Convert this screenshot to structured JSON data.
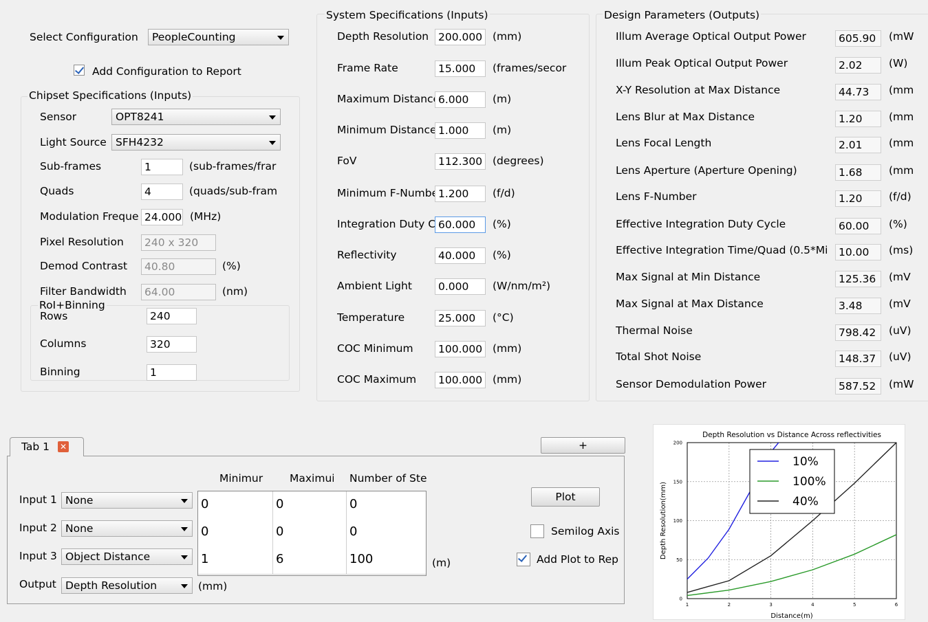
{
  "config": {
    "select_label": "Select Configuration",
    "select_value": "PeopleCounting",
    "add_to_report_label": "Add Configuration to Report",
    "add_to_report_checked": true
  },
  "chipset": {
    "title": "Chipset Specifications (Inputs)",
    "sensor_label": "Sensor",
    "sensor_value": "OPT8241",
    "light_source_label": "Light Source",
    "light_source_value": "SFH4232",
    "subframes_label": "Sub-frames",
    "subframes_value": "1",
    "subframes_unit": "(sub-frames/frar",
    "quads_label": "Quads",
    "quads_value": "4",
    "quads_unit": "(quads/sub-fram",
    "modfreq_label": "Modulation Freque",
    "modfreq_value": "24.000",
    "modfreq_unit": "(MHz)",
    "pixres_label": "Pixel Resolution",
    "pixres_value": "240 x 320",
    "demod_label": "Demod Contrast",
    "demod_value": "40.80",
    "demod_unit": "(%)",
    "filter_label": "Filter Bandwidth",
    "filter_value": "64.00",
    "filter_unit": "(nm)",
    "roi_title": "RoI+Binning",
    "rows_label": "Rows",
    "rows_value": "240",
    "columns_label": "Columns",
    "columns_value": "320",
    "binning_label": "Binning",
    "binning_value": "1"
  },
  "system": {
    "title": "System Specifications (Inputs)",
    "rows": [
      {
        "label": "Depth Resolution",
        "value": "200.000",
        "unit": "(mm)"
      },
      {
        "label": "Frame Rate",
        "value": "15.000",
        "unit": "(frames/secor"
      },
      {
        "label": "Maximum Distance",
        "value": "6.000",
        "unit": "(m)"
      },
      {
        "label": "Minimum Distance",
        "value": "1.000",
        "unit": "(m)"
      },
      {
        "label": "FoV",
        "value": "112.300",
        "unit": "(degrees)"
      },
      {
        "label": "Minimum F-Numbe",
        "value": "1.200",
        "unit": "(f/d)"
      },
      {
        "label": "Integration Duty C",
        "value": "60.000",
        "unit": "(%)"
      },
      {
        "label": "Reflectivity",
        "value": "40.000",
        "unit": "(%)"
      },
      {
        "label": "Ambient Light",
        "value": "0.000",
        "unit": "(W/nm/m²)"
      },
      {
        "label": "Temperature",
        "value": "25.000",
        "unit": "(°C)"
      },
      {
        "label": "COC Minimum",
        "value": "100.000",
        "unit": "(mm)"
      },
      {
        "label": "COC Maximum",
        "value": "100.000",
        "unit": "(mm)"
      }
    ]
  },
  "design": {
    "title": "Design Parameters (Outputs)",
    "rows": [
      {
        "label": "Illum Average Optical Output Power",
        "value": "605.90",
        "unit": "(mW"
      },
      {
        "label": "Illum Peak Optical Output Power",
        "value": "2.02",
        "unit": "(W)"
      },
      {
        "label": "X-Y Resolution at Max Distance",
        "value": "44.73",
        "unit": "(mm"
      },
      {
        "label": "Lens Blur at Max Distance",
        "value": "1.20",
        "unit": "(mm"
      },
      {
        "label": "Lens Focal Length",
        "value": "2.01",
        "unit": "(mm"
      },
      {
        "label": "Lens Aperture (Aperture Opening)",
        "value": "1.68",
        "unit": "(mm"
      },
      {
        "label": "Lens F-Number",
        "value": "1.20",
        "unit": "(f/d)"
      },
      {
        "label": "Effective Integration Duty Cycle",
        "value": "60.00",
        "unit": "(%)"
      },
      {
        "label": "Effective Integration Time/Quad (0.5*Mi",
        "value": "10.00",
        "unit": "(ms)"
      },
      {
        "label": "Max Signal at Min Distance",
        "value": "125.36",
        "unit": "(mV"
      },
      {
        "label": "Max Signal at Max Distance",
        "value": "3.48",
        "unit": "(mV"
      },
      {
        "label": "Thermal Noise",
        "value": "798.42",
        "unit": "(uV)"
      },
      {
        "label": "Total Shot Noise",
        "value": "148.37",
        "unit": "(uV)"
      },
      {
        "label": "Sensor Demodulation Power",
        "value": "587.52",
        "unit": "(mW"
      }
    ]
  },
  "tabs": {
    "tab1_label": "Tab 1",
    "add_tab_label": "+",
    "col_min": "Minimur",
    "col_max": "Maximui",
    "col_steps": "Number of Ste",
    "inputs": [
      {
        "label": "Input 1",
        "select": "None",
        "min": "0",
        "max": "0",
        "steps": "0"
      },
      {
        "label": "Input 2",
        "select": "None",
        "min": "0",
        "max": "0",
        "steps": "0"
      },
      {
        "label": "Input 3",
        "select": "Object Distance",
        "min": "1",
        "max": "6",
        "steps": "100"
      }
    ],
    "input3_unit": "(m)",
    "output_label": "Output",
    "output_select": "Depth Resolution",
    "output_unit": "(mm)",
    "plot_button": "Plot",
    "semilog_label": "Semilog Axis",
    "semilog_checked": false,
    "add_plot_label": "Add Plot to Rep",
    "add_plot_checked": true
  },
  "chart_data": {
    "type": "line",
    "title": "Depth Resolution vs Distance Across reflectivities",
    "xlabel": "Distance(m)",
    "ylabel": "Depth Resolution(mm)",
    "xlim": [
      1,
      6
    ],
    "ylim": [
      0,
      200
    ],
    "xticks": [
      "1",
      "2",
      "3",
      "4",
      "5",
      "6"
    ],
    "yticks": [
      "0",
      "50",
      "100",
      "150",
      "200"
    ],
    "grid": true,
    "legend_position": "top-center",
    "series": [
      {
        "name": "10%",
        "color": "#2020e0",
        "x": [
          1.0,
          1.5,
          2.0,
          2.5,
          3.0,
          3.2
        ],
        "y": [
          25,
          52,
          89,
          137,
          188,
          201
        ]
      },
      {
        "name": "100%",
        "color": "#2a9a2a",
        "x": [
          1.0,
          2.0,
          3.0,
          4.0,
          5.0,
          6.0
        ],
        "y": [
          4,
          11,
          22,
          37,
          57,
          82
        ]
      },
      {
        "name": "40%",
        "color": "#222222",
        "x": [
          1.0,
          2.0,
          3.0,
          4.0,
          5.0,
          6.0
        ],
        "y": [
          8,
          23,
          55,
          100,
          148,
          200
        ]
      }
    ]
  }
}
